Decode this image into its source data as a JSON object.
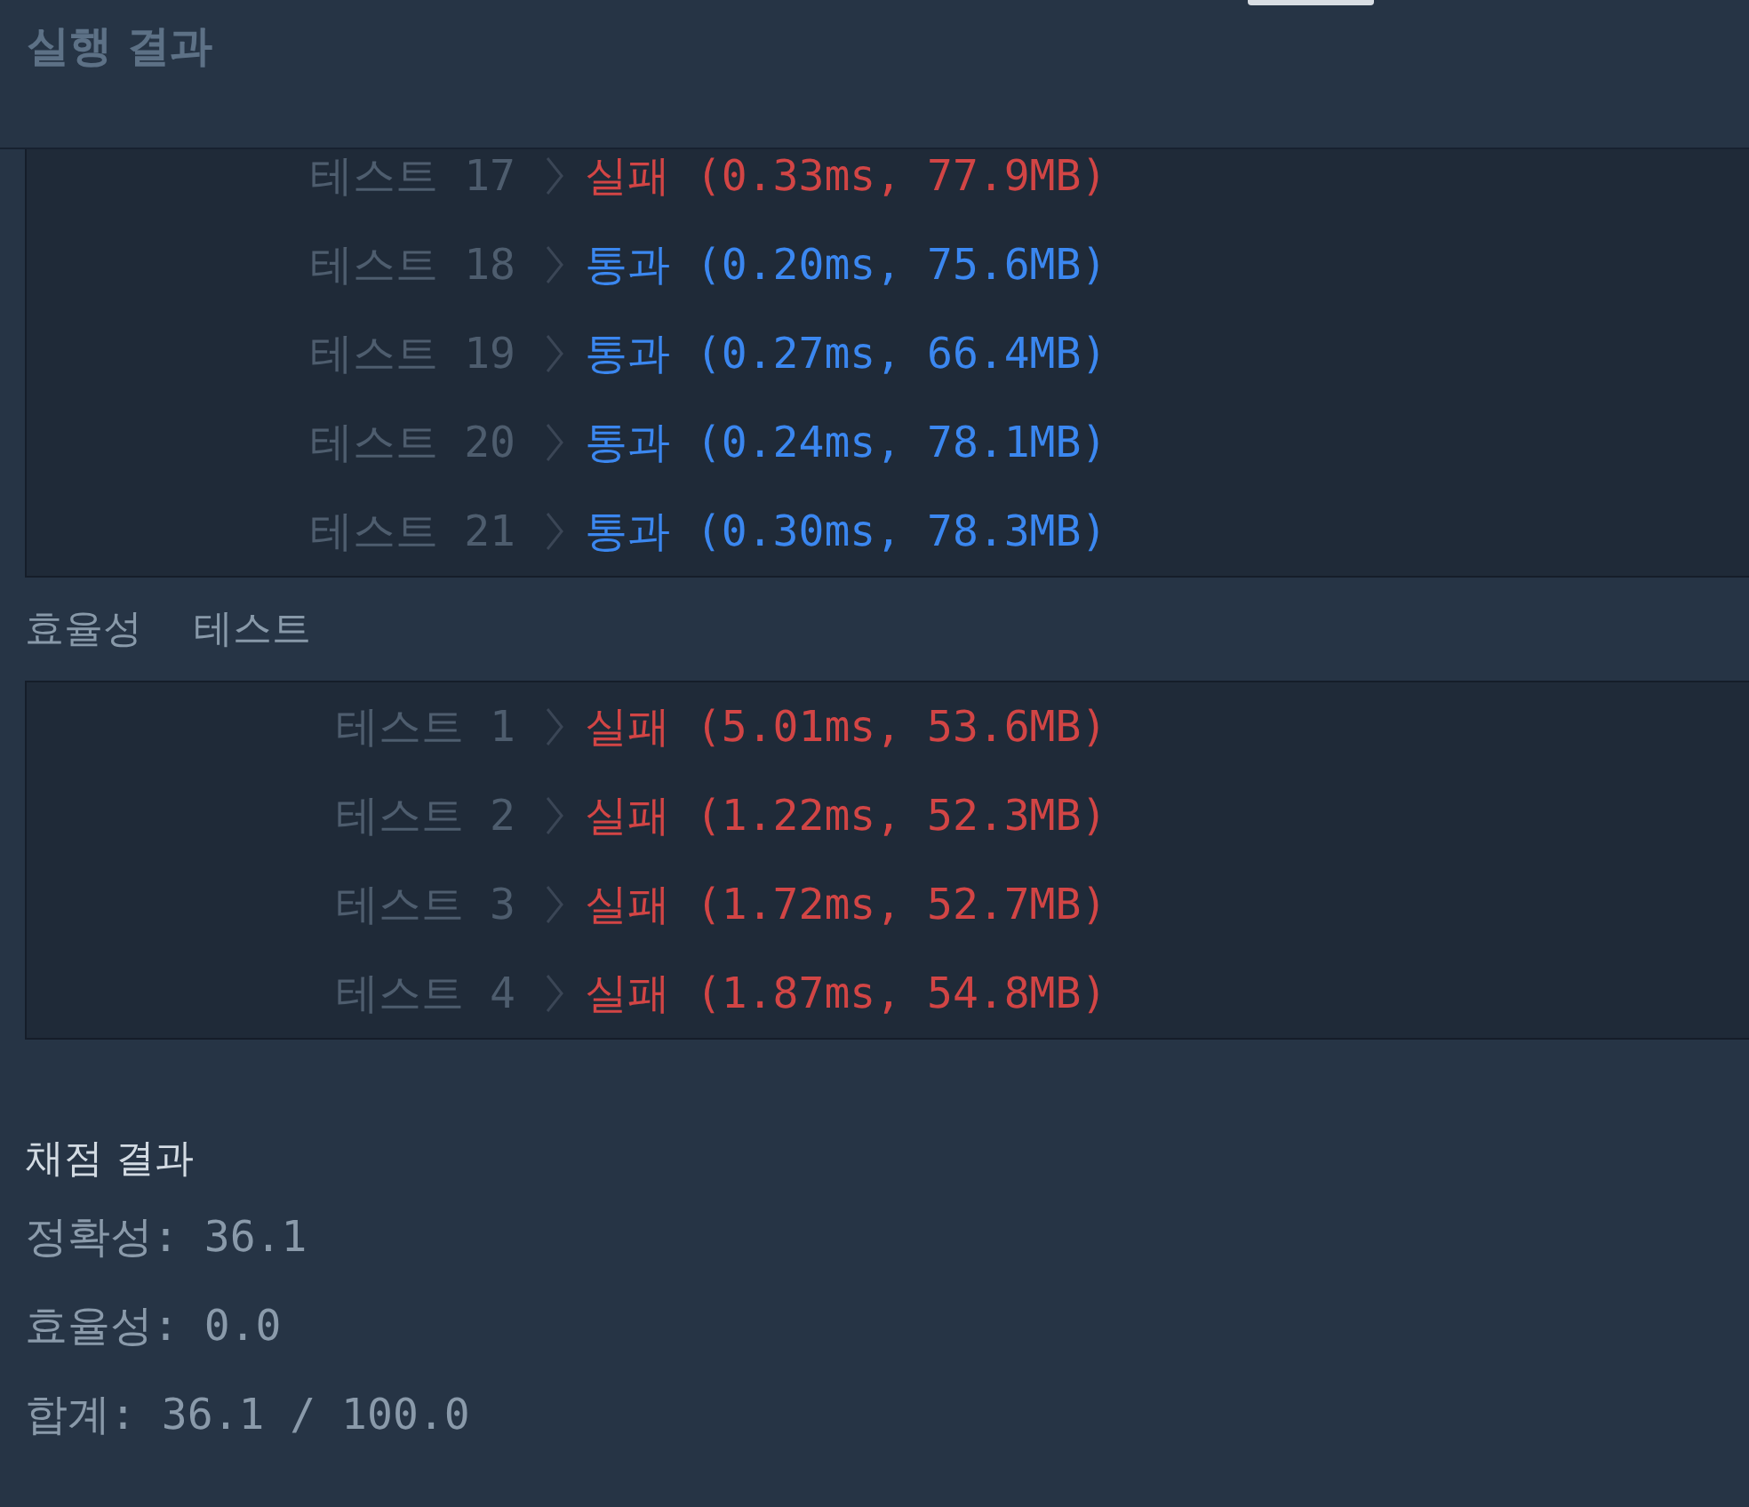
{
  "header": {
    "title": "실행 결과"
  },
  "accuracy_tests": {
    "rows": [
      {
        "label": "테스트 17",
        "kind": "fail",
        "result": "실패",
        "detail": "(0.33ms, 77.9MB)"
      },
      {
        "label": "테스트 18",
        "kind": "pass",
        "result": "통과",
        "detail": "(0.20ms, 75.6MB)"
      },
      {
        "label": "테스트 19",
        "kind": "pass",
        "result": "통과",
        "detail": "(0.27ms, 66.4MB)"
      },
      {
        "label": "테스트 20",
        "kind": "pass",
        "result": "통과",
        "detail": "(0.24ms, 78.1MB)"
      },
      {
        "label": "테스트 21",
        "kind": "pass",
        "result": "통과",
        "detail": "(0.30ms, 78.3MB)"
      }
    ]
  },
  "efficiency_tests": {
    "title": "효율성 테스트",
    "rows": [
      {
        "label": "테스트 1",
        "kind": "fail",
        "result": "실패",
        "detail": "(5.01ms, 53.6MB)"
      },
      {
        "label": "테스트 2",
        "kind": "fail",
        "result": "실패",
        "detail": "(1.22ms, 52.3MB)"
      },
      {
        "label": "테스트 3",
        "kind": "fail",
        "result": "실패",
        "detail": "(1.72ms, 52.7MB)"
      },
      {
        "label": "테스트 4",
        "kind": "fail",
        "result": "실패",
        "detail": "(1.87ms, 54.8MB)"
      }
    ]
  },
  "grading": {
    "title": "채점 결과",
    "lines": [
      "정확성: 36.1",
      "효율성: 0.0",
      "합계: 36.1 / 100.0"
    ]
  }
}
